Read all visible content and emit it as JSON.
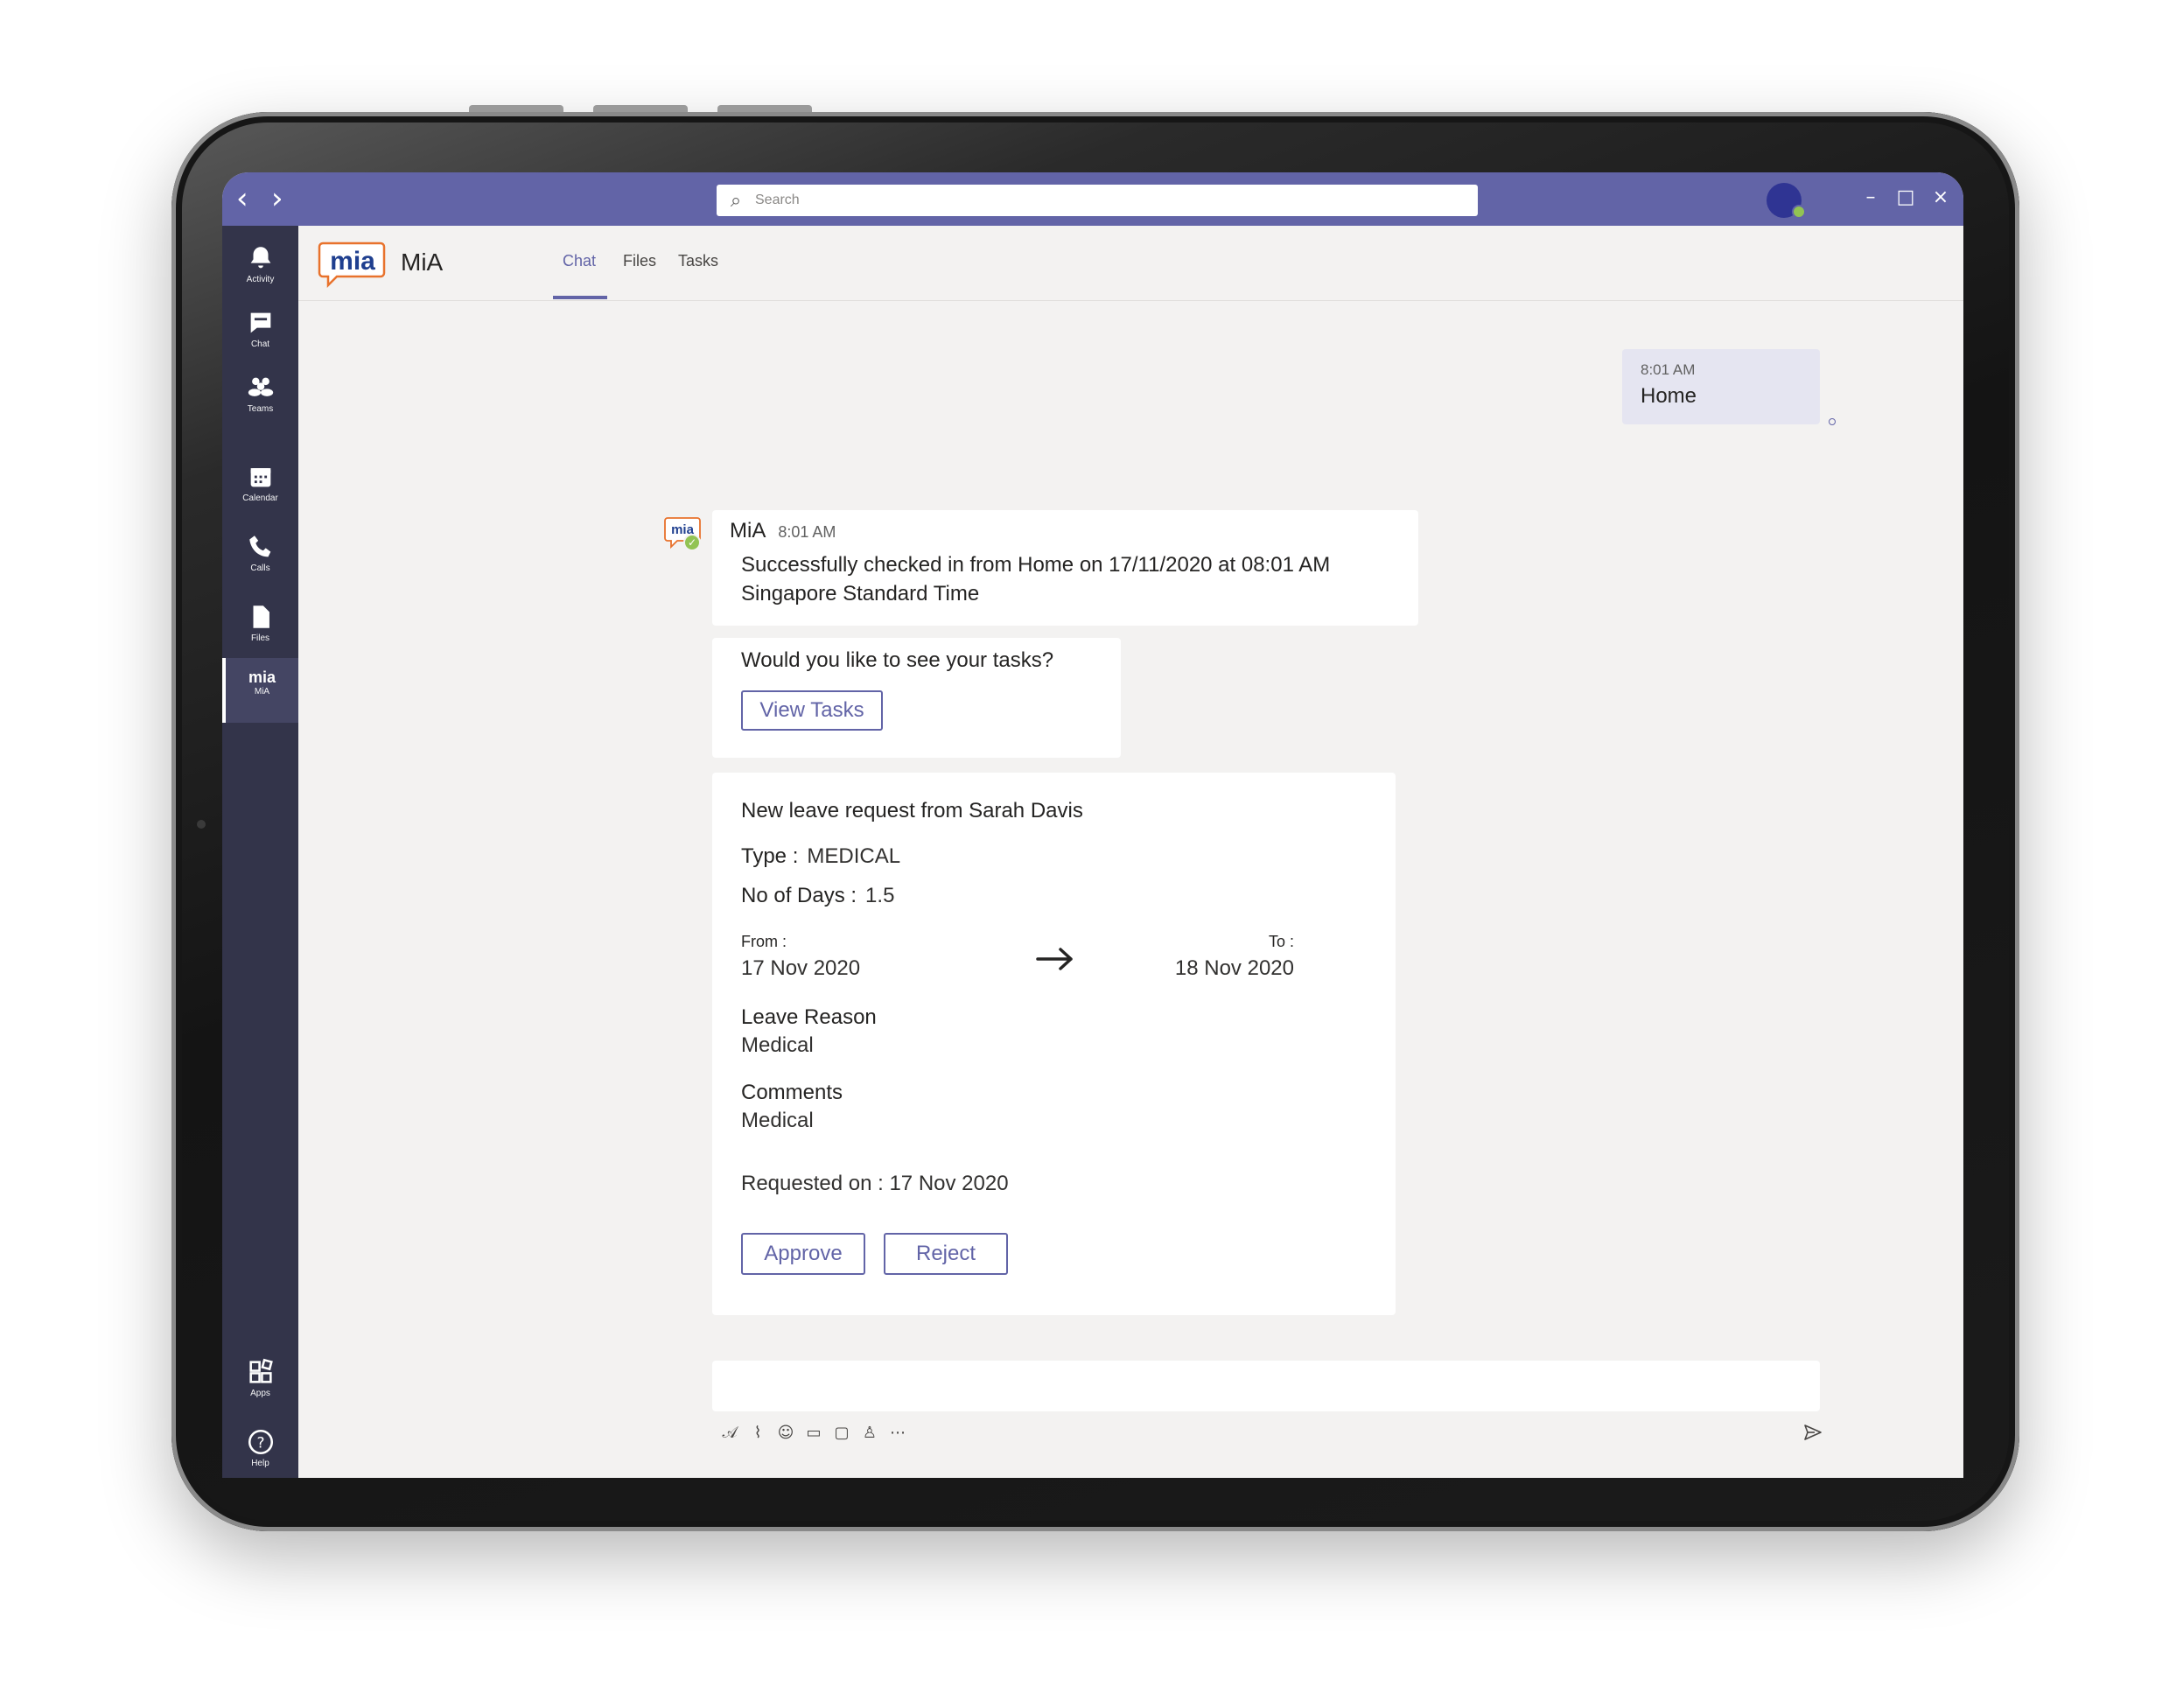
{
  "titlebar": {
    "search_placeholder": "Search",
    "back_glyph": "‹",
    "forward_glyph": "›",
    "minimize_glyph": "–",
    "maximize_glyph": "□",
    "close_glyph": "×"
  },
  "rail": {
    "items": [
      {
        "label": "Activity",
        "icon": "bell-icon"
      },
      {
        "label": "Chat",
        "icon": "chat-icon"
      },
      {
        "label": "Teams",
        "icon": "teams-icon"
      },
      {
        "label": "Calendar",
        "icon": "calendar-icon"
      },
      {
        "label": "Calls",
        "icon": "phone-icon"
      },
      {
        "label": "Files",
        "icon": "file-icon"
      },
      {
        "label": "MiA",
        "icon": "mia-icon",
        "active": true
      },
      {
        "label": "Apps",
        "icon": "apps-icon"
      },
      {
        "label": "Help",
        "icon": "help-icon"
      }
    ],
    "mia_mini_text": "mia"
  },
  "header": {
    "logo_text": "mia",
    "app_name": "MiA",
    "tabs": [
      {
        "label": "Chat",
        "active": true
      },
      {
        "label": "Files"
      },
      {
        "label": "Tasks"
      }
    ]
  },
  "messages": {
    "sent": {
      "time": "8:01 AM",
      "text": "Home"
    },
    "bot_avatar_text": "mia",
    "bot": {
      "sender": "MiA",
      "time": "8:01 AM",
      "text": "Successfully checked in from Home on 17/11/2020 at 08:01 AM Singapore Standard Time"
    },
    "prompt": {
      "question": "Would you like to see your tasks?",
      "button": "View Tasks"
    },
    "leave_card": {
      "title": "New leave request from Sarah Davis",
      "type_label": "Type :",
      "type_value": "MEDICAL",
      "days_label": "No of Days :",
      "days_value": "1.5",
      "from_label": "From :",
      "from_value": "17 Nov 2020",
      "to_label": "To :",
      "to_value": "18 Nov 2020",
      "reason_label": "Leave Reason",
      "reason_value": "Medical",
      "comments_label": "Comments",
      "comments_value": "Medical",
      "requested_on": "Requested on : 17 Nov 2020",
      "approve_label": "Approve",
      "reject_label": "Reject"
    }
  },
  "compose": {
    "tools": [
      "format-icon",
      "attach-icon",
      "emoji-icon",
      "gif-icon",
      "sticker-icon",
      "praise-icon",
      "more-icon"
    ],
    "tool_glyphs": [
      "𝒜",
      "⌇",
      "☺",
      "▭",
      "▢",
      "♙",
      "⋯"
    ]
  },
  "colors": {
    "brand": "#6264a7",
    "rail": "#33344a",
    "background": "#f3f2f1",
    "sent_bubble": "#e5e5f1",
    "presence": "#92c353"
  }
}
